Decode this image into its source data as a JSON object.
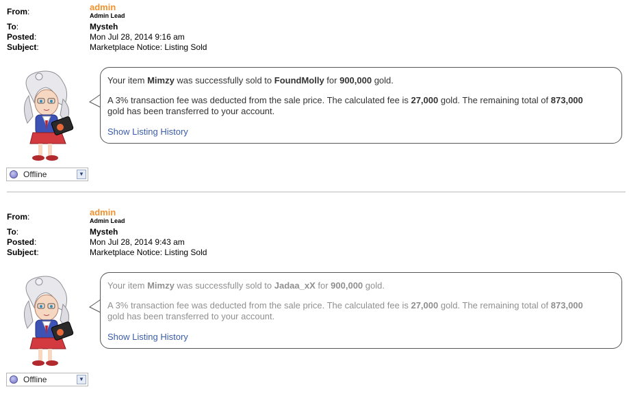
{
  "labels": {
    "from": "From",
    "to": "To",
    "posted": "Posted",
    "subject": "Subject"
  },
  "messages": [
    {
      "sender": "admin",
      "sender_title": "Admin Lead",
      "to": "Mysteh",
      "posted": "Mon Jul 28, 2014 9:16 am",
      "subject": "Marketplace Notice: Listing Sold",
      "line1_pre": "Your item ",
      "item": "Mimzy",
      "line1_mid": " was successfully sold to ",
      "buyer": "FoundMolly",
      "line1_mid2": " for ",
      "price": "900,000",
      "line1_post": " gold.",
      "line2_pre": "A 3% transaction fee was deducted from the sale price. The calculated fee is ",
      "fee": "27,000",
      "line2_mid": " gold. The remaining total of ",
      "remaining": "873,000",
      "line2_post": " gold has been transferred to your account.",
      "link": "Show Listing History",
      "status": "Offline"
    },
    {
      "sender": "admin",
      "sender_title": "Admin Lead",
      "to": "Mysteh",
      "posted": "Mon Jul 28, 2014 9:43 am",
      "subject": "Marketplace Notice: Listing Sold",
      "line1_pre": "Your item ",
      "item": "Mimzy",
      "line1_mid": " was successfully sold to ",
      "buyer": "Jadaa_xX",
      "line1_mid2": " for ",
      "price": "900,000",
      "line1_post": " gold.",
      "line2_pre": "A 3% transaction fee was deducted from the sale price. The calculated fee is ",
      "fee": "27,000",
      "line2_mid": " gold. The remaining total of ",
      "remaining": "873,000",
      "line2_post": " gold has been transferred to your account.",
      "link": "Show Listing History",
      "status": "Offline"
    }
  ],
  "colors": {
    "sender": "#f3912f",
    "link": "#3b5ca8",
    "status_dot": "#6e70c8"
  },
  "icons": {
    "status": "offline-status-icon",
    "dropdown": "dropdown-arrow-icon"
  }
}
